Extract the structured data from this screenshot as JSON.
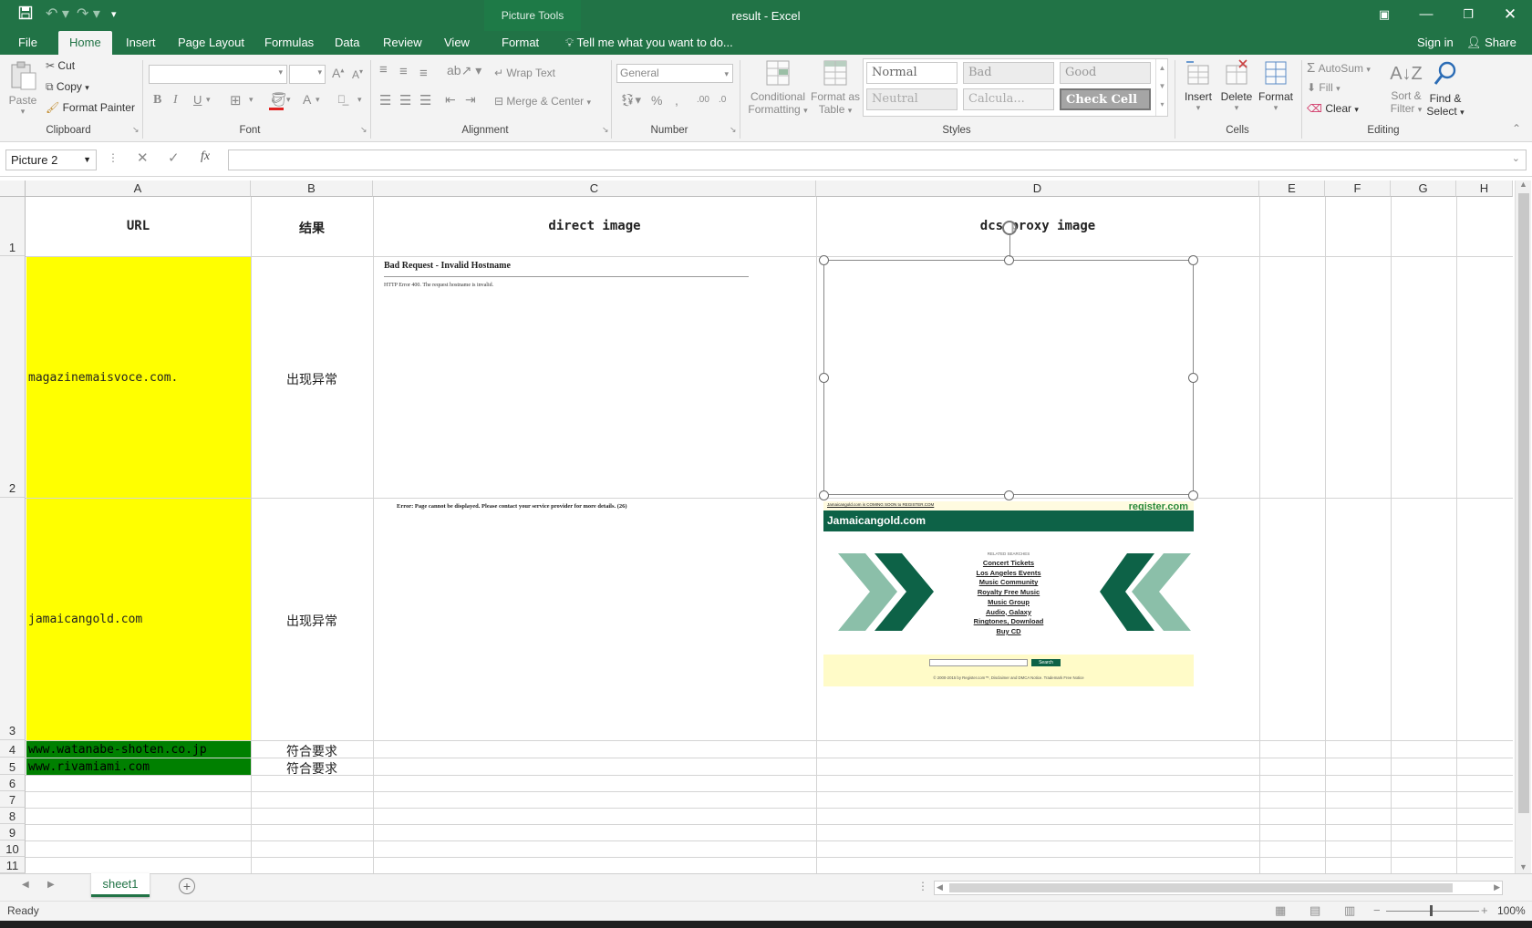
{
  "window": {
    "doc_title": "result - Excel",
    "context_tab_group": "Picture Tools"
  },
  "tabs": [
    "File",
    "Home",
    "Insert",
    "Page Layout",
    "Formulas",
    "Data",
    "Review",
    "View",
    "Format"
  ],
  "active_tab": "Home",
  "tell_me": "Tell me what you want to do...",
  "sign_in": "Sign in",
  "share": "Share",
  "ribbon": {
    "clipboard": {
      "paste": "Paste",
      "cut": "Cut",
      "copy": "Copy",
      "format_painter": "Format Painter",
      "label": "Clipboard"
    },
    "font": {
      "label": "Font",
      "bold": "B",
      "italic": "I",
      "underline": "U"
    },
    "alignment": {
      "wrap_text": "Wrap Text",
      "merge_center": "Merge & Center",
      "label": "Alignment"
    },
    "number": {
      "format": "General",
      "label": "Number"
    },
    "styles": {
      "conditional_formatting": [
        "Conditional",
        "Formatting"
      ],
      "format_as_table": [
        "Format as",
        "Table"
      ],
      "normal": "Normal",
      "bad": "Bad",
      "good": "Good",
      "neutral": "Neutral",
      "calculation": "Calcula...",
      "check_cell": "Check Cell",
      "label": "Styles"
    },
    "cells": {
      "insert": "Insert",
      "delete": "Delete",
      "format": "Format",
      "label": "Cells"
    },
    "editing": {
      "autosum": "AutoSum",
      "fill": "Fill",
      "clear": "Clear",
      "sort_filter": [
        "Sort &",
        "Filter"
      ],
      "find_select": [
        "Find &",
        "Select"
      ],
      "label": "Editing"
    }
  },
  "formula_bar": {
    "name_box": "Picture 2",
    "fx": "fx",
    "formula": ""
  },
  "columns": [
    "A",
    "B",
    "C",
    "D",
    "E",
    "F",
    "G",
    "H"
  ],
  "rows": [
    "1",
    "2",
    "3",
    "4",
    "5",
    "6",
    "7",
    "8",
    "9",
    "10",
    "11"
  ],
  "headers": {
    "url": "URL",
    "result": "结果",
    "direct": "direct image",
    "proxy": "dcs proxy image"
  },
  "data_rows": [
    {
      "url": "magazinemaisvoce.com.",
      "result": "出现异常"
    },
    {
      "url": "jamaicangold.com",
      "result": "出现异常"
    },
    {
      "url": "www.watanabe-shoten.co.jp",
      "result": "符合要求"
    },
    {
      "url": "www.rivamiami.com",
      "result": "符合要求"
    }
  ],
  "direct_images": {
    "row2_title": "Bad Request - Invalid Hostname",
    "row2_body": "HTTP Error 400. The request hostname is invalid.",
    "row3_error": "Error: Page cannot be displayed. Please contact your service provider for more details. (26)"
  },
  "proxy_image": {
    "top_notice": "Jamaicangold.com is COMING SOON to REGISTER.COM",
    "brand": "register.com",
    "site": "Jamaicangold.com",
    "related": "RELATED SEARCHES",
    "links": [
      "Concert Tickets",
      "Los Angeles Events",
      "Music Community",
      "Royalty Free Music",
      "Music Group",
      "Audio, Galaxy",
      "Ringtones, Download",
      "Buy CD"
    ],
    "search_btn": "Search",
    "footer": "© 2000-2015 by Register.com™, Disclaimer and DMCA Notice. Trademark Free Notice"
  },
  "sheets": [
    "sheet1"
  ],
  "status": {
    "ready": "Ready",
    "zoom": "100%"
  },
  "colors": {
    "excel_green": "#217346",
    "yellow": "#ffff00",
    "dark_green": "#008000"
  }
}
